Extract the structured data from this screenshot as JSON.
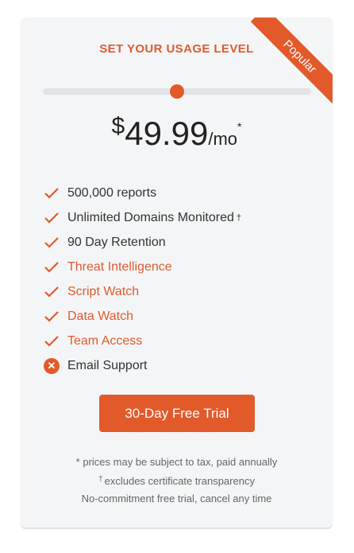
{
  "card": {
    "ribbon": "Popular",
    "heading": "SET YOUR USAGE LEVEL",
    "slider": {
      "level": 0.5
    },
    "price": {
      "currency": "$",
      "amount": "49.99",
      "period": "/mo",
      "asterisk": "*"
    },
    "features": [
      {
        "label": "500,000 reports",
        "included": true,
        "highlight": false,
        "mark": ""
      },
      {
        "label": "Unlimited Domains Monitored",
        "included": true,
        "highlight": false,
        "mark": "†"
      },
      {
        "label": "90 Day Retention",
        "included": true,
        "highlight": false,
        "mark": ""
      },
      {
        "label": "Threat Intelligence",
        "included": true,
        "highlight": true,
        "mark": ""
      },
      {
        "label": "Script Watch",
        "included": true,
        "highlight": true,
        "mark": ""
      },
      {
        "label": "Data Watch",
        "included": true,
        "highlight": true,
        "mark": ""
      },
      {
        "label": "Team Access",
        "included": true,
        "highlight": true,
        "mark": ""
      },
      {
        "label": "Email Support",
        "included": false,
        "highlight": false,
        "mark": ""
      }
    ],
    "cta_label": "30-Day Free Trial",
    "notes": {
      "line1": "* prices may be subject to tax, paid annually",
      "line2_mark": "†",
      "line2": "excludes certificate transparency",
      "line3": "No-commitment free trial, cancel any time"
    }
  },
  "colors": {
    "accent": "#e25a2a",
    "text": "#333333",
    "card_bg": "#f4f5f6"
  },
  "icons": {
    "included": "check-icon",
    "excluded": "close-circle-icon"
  }
}
